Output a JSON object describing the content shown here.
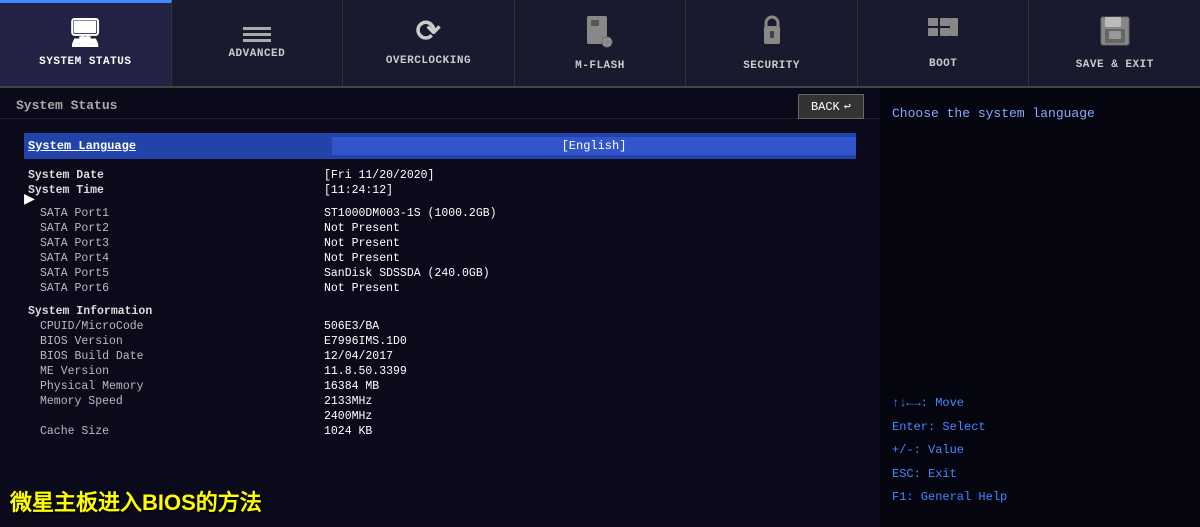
{
  "nav": {
    "items": [
      {
        "id": "system-status",
        "label": "System Status",
        "icon": "monitor",
        "active": true
      },
      {
        "id": "advanced",
        "label": "Advanced",
        "icon": "advanced",
        "active": false
      },
      {
        "id": "overclocking",
        "label": "Overclocking",
        "icon": "overclocking",
        "active": false
      },
      {
        "id": "mflash",
        "label": "M-Flash",
        "icon": "mflash",
        "active": false
      },
      {
        "id": "security",
        "label": "Security",
        "icon": "security",
        "active": false
      },
      {
        "id": "boot",
        "label": "Boot",
        "icon": "boot",
        "active": false
      },
      {
        "id": "save-exit",
        "label": "Save & Exit",
        "icon": "saveexit",
        "active": false
      }
    ]
  },
  "left": {
    "section_title": "System Status",
    "back_label": "BACK",
    "system_language_label": "System Language",
    "system_language_value": "[English]",
    "rows": [
      {
        "label": "System Date",
        "value": "[Fri 11/20/2020]"
      },
      {
        "label": "System Time",
        "value": "[11:24:12]"
      },
      {
        "label": "",
        "value": ""
      },
      {
        "label": "SATA Port1",
        "value": "ST1000DM003-1S (1000.2GB)"
      },
      {
        "label": "SATA Port2",
        "value": "Not Present"
      },
      {
        "label": "SATA Port3",
        "value": "Not Present"
      },
      {
        "label": "SATA Port4",
        "value": "Not Present"
      },
      {
        "label": "SATA Port5",
        "value": "SanDisk SDSSDA (240.0GB)"
      },
      {
        "label": "SATA Port6",
        "value": "Not Present"
      },
      {
        "label": "",
        "value": ""
      },
      {
        "label": "System Information",
        "value": "",
        "section": true
      },
      {
        "label": "CPUID/MicroCode",
        "value": "506E3/BA"
      },
      {
        "label": "BIOS Version",
        "value": "E7996IMS.1D0"
      },
      {
        "label": "BIOS Build Date",
        "value": "12/04/2017"
      },
      {
        "label": "ME Version",
        "value": "11.8.50.3399"
      },
      {
        "label": "Physical Memory",
        "value": "16384 MB"
      },
      {
        "label": "Memory Speed",
        "value": "2133MHz"
      },
      {
        "label": "",
        "value": "2400MHz"
      },
      {
        "label": "Cache Size",
        "value": "1024 KB"
      }
    ]
  },
  "right": {
    "help_text": "Choose the system language",
    "key_hints": [
      "↑↓←→: Move",
      "Enter: Select",
      "+/-: Value",
      "ESC: Exit",
      "F1: General Help"
    ]
  },
  "watermark": {
    "text": "微星主板进入BIOS的方法"
  }
}
